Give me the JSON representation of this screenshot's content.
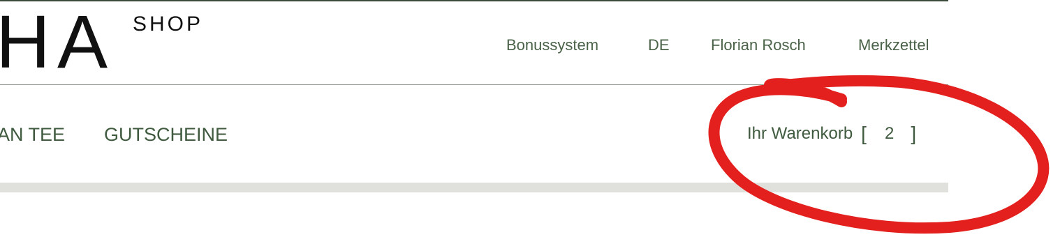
{
  "brand": {
    "logo_text": "HA",
    "logo_sub": "SHOP"
  },
  "top_nav": {
    "bonus": "Bonussystem",
    "language": "DE",
    "user": "Florian Rosch",
    "wishlist": "Merkzettel"
  },
  "main_nav": {
    "tee": "AN TEE",
    "vouchers": "GUTSCHEINE"
  },
  "cart": {
    "label": "Ihr Warenkorb",
    "open_bracket": "[",
    "count": "2",
    "close_bracket": "]"
  },
  "colors": {
    "nav_green": "#4a6248",
    "annotation_red": "#e3201e",
    "bar_grey": "#e0e0dc"
  }
}
